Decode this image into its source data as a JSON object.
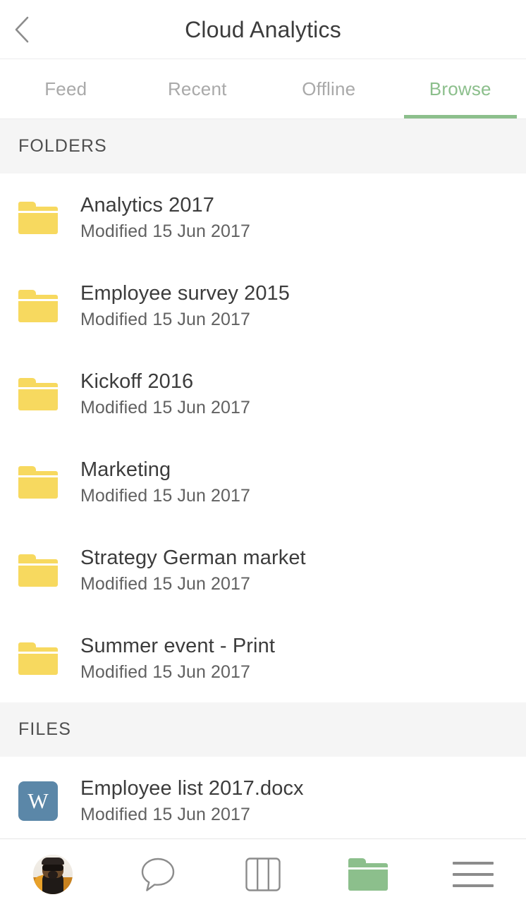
{
  "header": {
    "title": "Cloud Analytics",
    "back_icon": "chevron-left-icon"
  },
  "tabs": [
    {
      "label": "Feed",
      "active": false
    },
    {
      "label": "Recent",
      "active": false
    },
    {
      "label": "Offline",
      "active": false
    },
    {
      "label": "Browse",
      "active": true
    }
  ],
  "sections": [
    {
      "header": "FOLDERS",
      "items": [
        {
          "icon": "folder-icon",
          "title": "Analytics 2017",
          "subtitle": "Modified 15 Jun 2017"
        },
        {
          "icon": "folder-icon",
          "title": "Employee survey 2015",
          "subtitle": "Modified 15 Jun 2017"
        },
        {
          "icon": "folder-icon",
          "title": "Kickoff 2016",
          "subtitle": "Modified 15 Jun 2017"
        },
        {
          "icon": "folder-icon",
          "title": "Marketing",
          "subtitle": "Modified 15 Jun 2017"
        },
        {
          "icon": "folder-icon",
          "title": "Strategy German market",
          "subtitle": "Modified 15 Jun 2017"
        },
        {
          "icon": "folder-icon",
          "title": "Summer event - Print",
          "subtitle": "Modified 15 Jun 2017"
        }
      ]
    },
    {
      "header": "FILES",
      "items": [
        {
          "icon": "word-document-icon",
          "icon_letter": "W",
          "title": "Employee list 2017.docx",
          "subtitle": "Modified 15 Jun 2017"
        }
      ]
    }
  ],
  "bottom_nav": [
    {
      "icon": "user-avatar",
      "active": false
    },
    {
      "icon": "chat-bubble-icon",
      "active": false
    },
    {
      "icon": "columns-board-icon",
      "active": false
    },
    {
      "icon": "folder-icon",
      "active": true
    },
    {
      "icon": "hamburger-menu-icon",
      "active": false
    }
  ],
  "colors": {
    "accent_green": "#8cbf8c",
    "folder_yellow": "#f7d95f",
    "word_blue": "#5b87a8",
    "section_band": "#f5f5f5",
    "text_primary": "#3c3c3c",
    "text_secondary": "#616161",
    "text_muted": "#a9a9a9",
    "icon_gray": "#8c8c8c"
  }
}
